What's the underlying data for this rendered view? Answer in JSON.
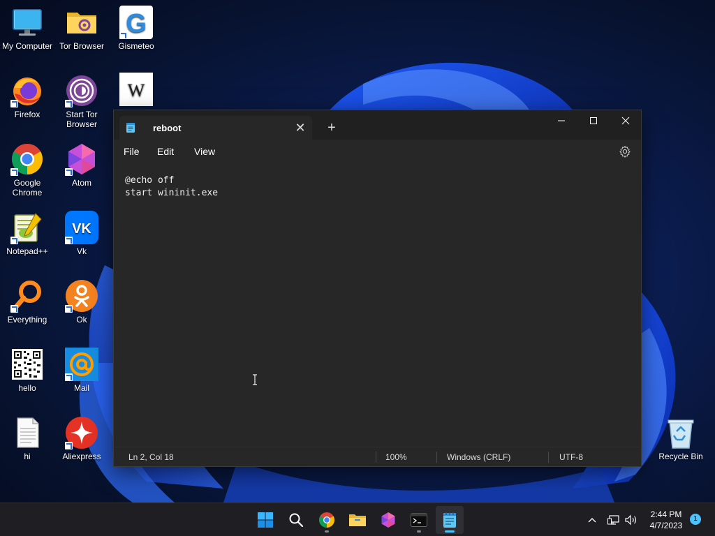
{
  "desktop": {
    "icons": [
      {
        "label": "My Computer"
      },
      {
        "label": "Tor Browser"
      },
      {
        "label": "Gismeteo"
      },
      {
        "label": "Firefox"
      },
      {
        "label": "Start Tor Browser"
      },
      {
        "label": "Google Chrome"
      },
      {
        "label": "Atom"
      },
      {
        "label": "Notepad++"
      },
      {
        "label": "Vk"
      },
      {
        "label": "Everything"
      },
      {
        "label": "Ok"
      },
      {
        "label": "hello"
      },
      {
        "label": "Mail"
      },
      {
        "label": "hi"
      },
      {
        "label": "Aliexpress"
      },
      {
        "label": "Recycle Bin"
      }
    ],
    "wiki_glyph": "W",
    "gismeteo_glyph": "G",
    "vk_glyph": "VK"
  },
  "notepad": {
    "tab_title": "reboot",
    "tab_close": "✕",
    "new_tab": "+",
    "menu": {
      "file": "File",
      "edit": "Edit",
      "view": "View"
    },
    "content": "@echo off\nstart wininit.exe",
    "status": {
      "position": "Ln 2, Col 18",
      "zoom": "100%",
      "line_ending": "Windows (CRLF)",
      "encoding": "UTF-8"
    }
  },
  "taskbar": {
    "time": "2:44 PM",
    "date": "4/7/2023",
    "notification_count": "1"
  },
  "colors": {
    "accent": "#4cc2ff",
    "window_bg": "#272727",
    "titlebar_bg": "#202020",
    "taskbar_bg": "#1f1f23"
  }
}
